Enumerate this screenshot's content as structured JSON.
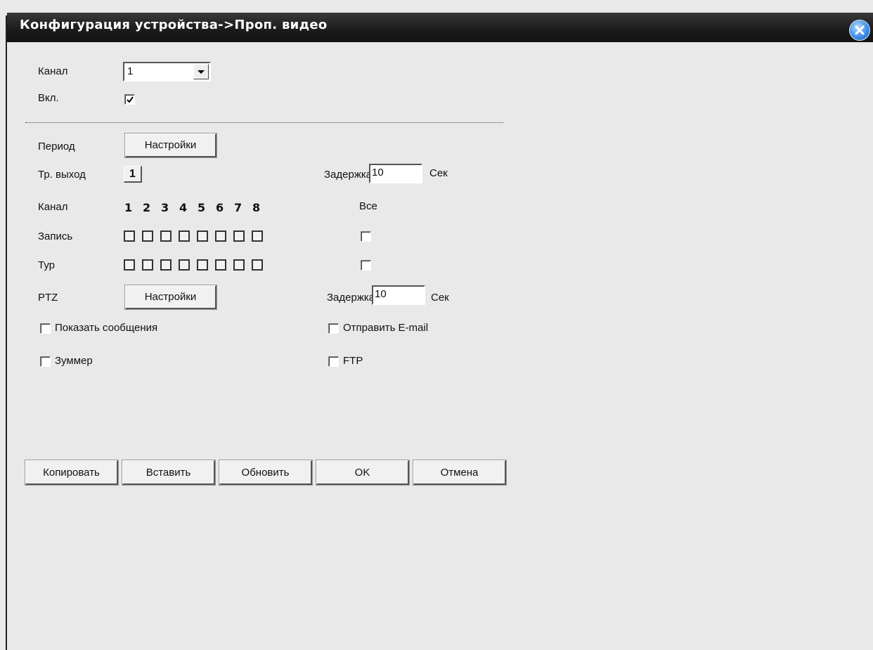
{
  "window": {
    "title": "Конфигурация устройства->Проп. видео"
  },
  "channel": {
    "label": "Канал",
    "value": "1"
  },
  "enable": {
    "label": "Вкл.",
    "checked": true
  },
  "period": {
    "label": "Период",
    "button": "Настройки"
  },
  "alarm_out": {
    "label": "Тр. выход",
    "value": "1",
    "delay_label": "Задержка",
    "delay_value": "10",
    "unit": "Сек"
  },
  "channels_row": {
    "label": "Канал",
    "numbers": [
      "1",
      "2",
      "3",
      "4",
      "5",
      "6",
      "7",
      "8"
    ],
    "all_label": "Все"
  },
  "record": {
    "label": "Запись"
  },
  "tour": {
    "label": "Тур"
  },
  "ptz": {
    "label": "PTZ",
    "button": "Настройки",
    "delay_label": "Задержка",
    "delay_value": "10",
    "unit": "Сек"
  },
  "options": {
    "show_message": "Показать сообщения",
    "send_email": "Отправить E-mail",
    "buzzer": "Зуммер",
    "ftp": "FTP"
  },
  "footer": {
    "copy": "Копировать",
    "paste": "Вставить",
    "refresh": "Обновить",
    "ok": "OK",
    "cancel": "Отмена"
  }
}
